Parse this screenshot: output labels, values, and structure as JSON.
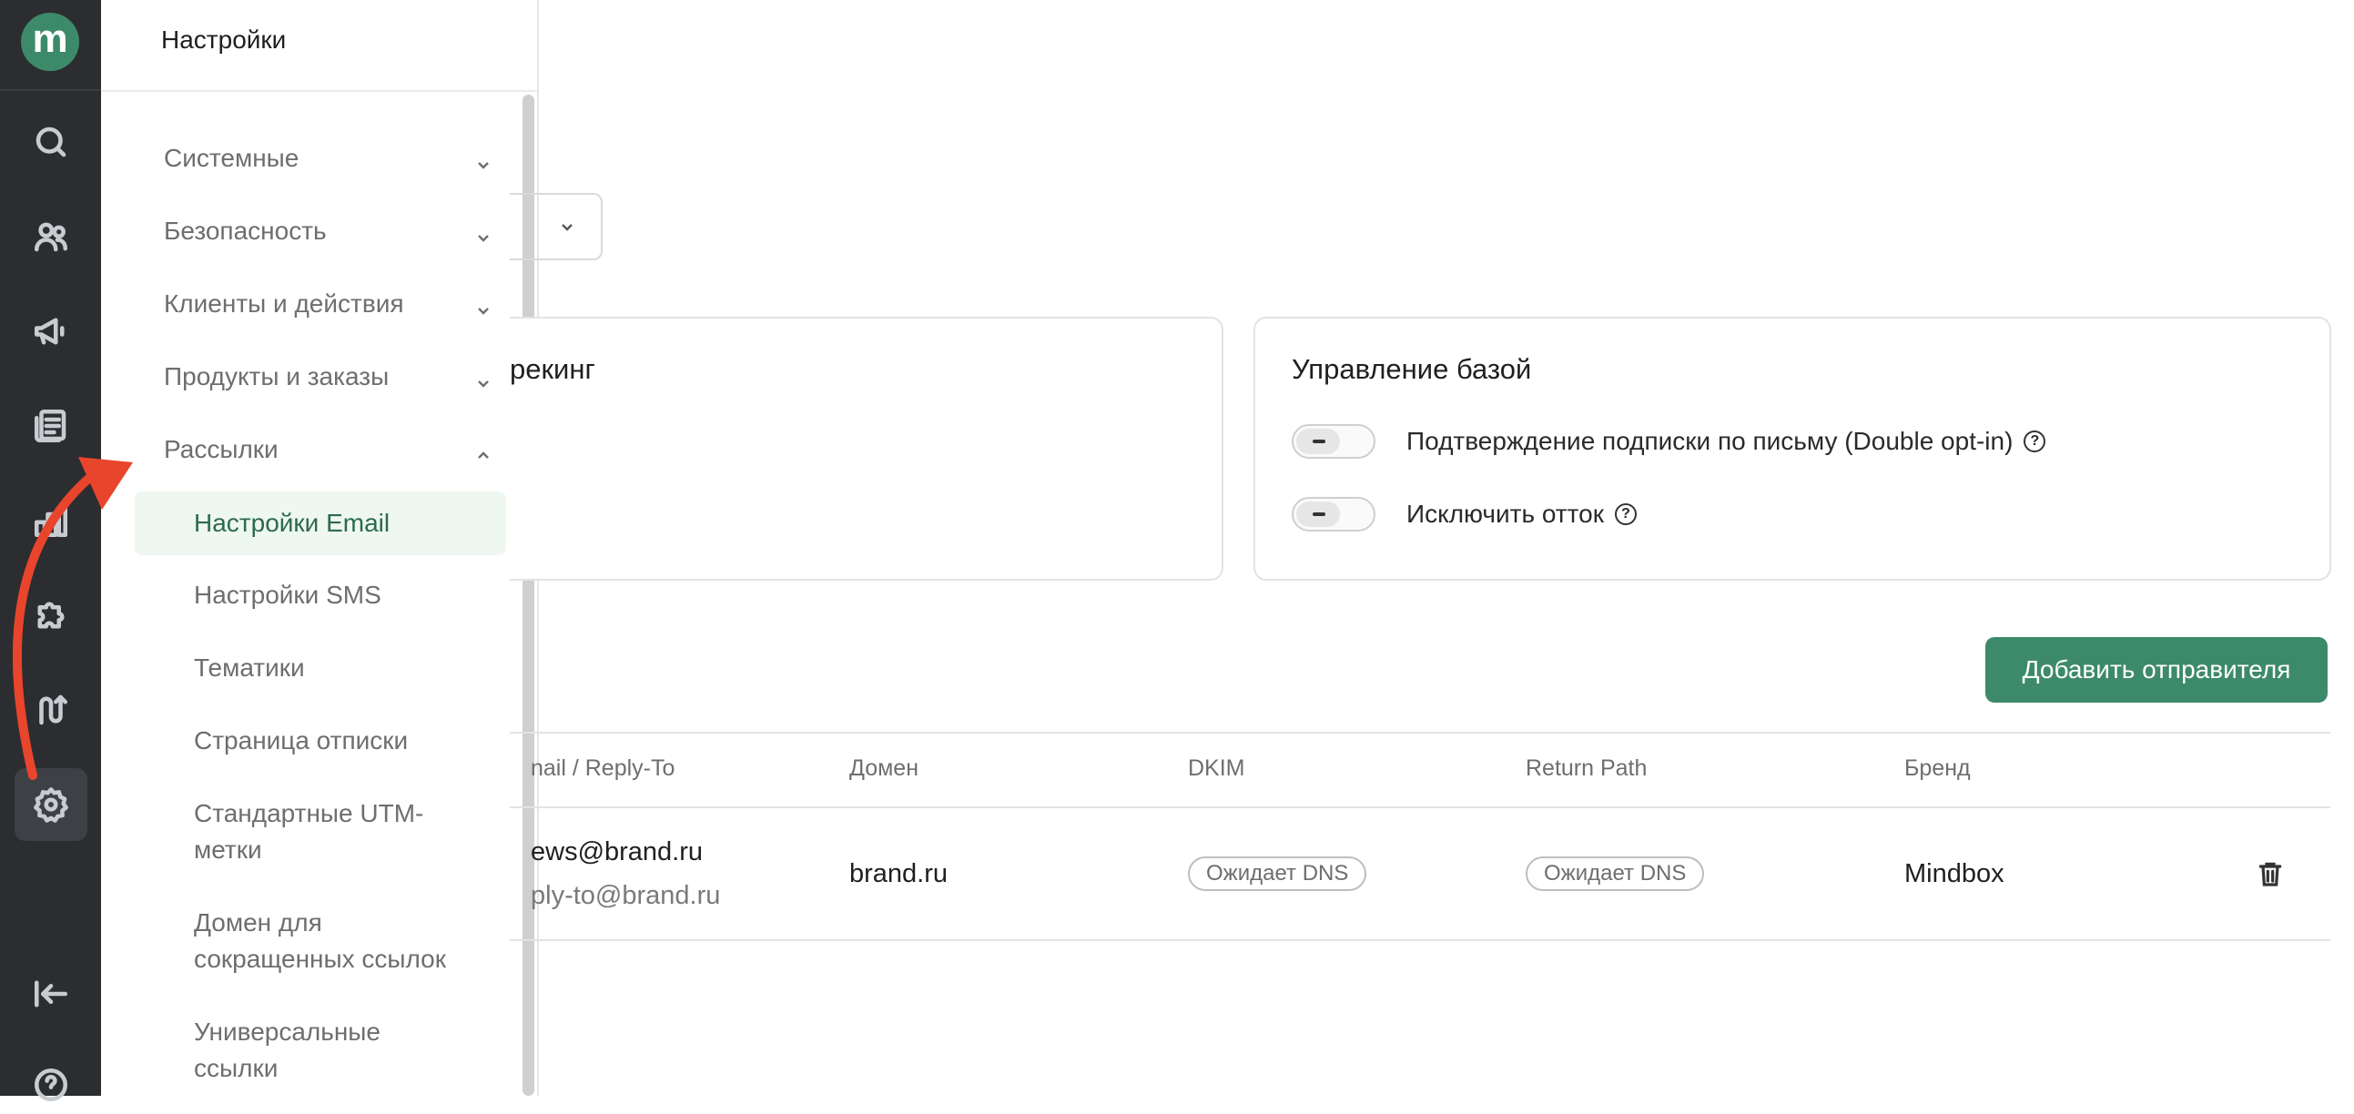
{
  "rail": {
    "logo": "m",
    "icons": [
      "search-icon",
      "users-icon",
      "megaphone-icon",
      "newsletter-icon",
      "analytics-icon",
      "puzzle-icon",
      "route-icon",
      "gear-icon",
      "collapse-icon",
      "help-icon"
    ]
  },
  "panel": {
    "title": "Настройки",
    "groups": [
      {
        "label": "Системные"
      },
      {
        "label": "Безопасность"
      },
      {
        "label": "Клиенты и действия"
      },
      {
        "label": "Продукты и заказы"
      },
      {
        "label": "Рассылки"
      }
    ],
    "subitems": [
      {
        "label": "Настройки Email"
      },
      {
        "label": "Настройки SMS"
      },
      {
        "label": "Тематики"
      },
      {
        "label": "Страница отписки"
      },
      {
        "label": "Стандартные UTM-\nметки"
      },
      {
        "label": "Домен для\nсокращенных ссылок"
      },
      {
        "label": "Универсальные\nссылки"
      }
    ]
  },
  "cards": {
    "left_title_fragment": "рекинг",
    "right_title": "Управление базой",
    "toggles": [
      {
        "label": "Подтверждение подписки по письму (Double opt-in)"
      },
      {
        "label": "Исключить отток"
      }
    ]
  },
  "toolbar": {
    "add_sender": "Добавить отправителя"
  },
  "table": {
    "headers": [
      "nail / Reply-To",
      "Домен",
      "DKIM",
      "Return Path",
      "Бренд"
    ],
    "row": {
      "email": "ews@brand.ru",
      "reply_to": "ply-to@brand.ru",
      "domain": "brand.ru",
      "dkim": "Ожидает DNS",
      "return_path": "Ожидает DNS",
      "brand": "Mindbox"
    }
  },
  "colors": {
    "accent": "#3d8a6a",
    "rail_bg": "#2b2d30",
    "arrow": "#e8452c"
  }
}
